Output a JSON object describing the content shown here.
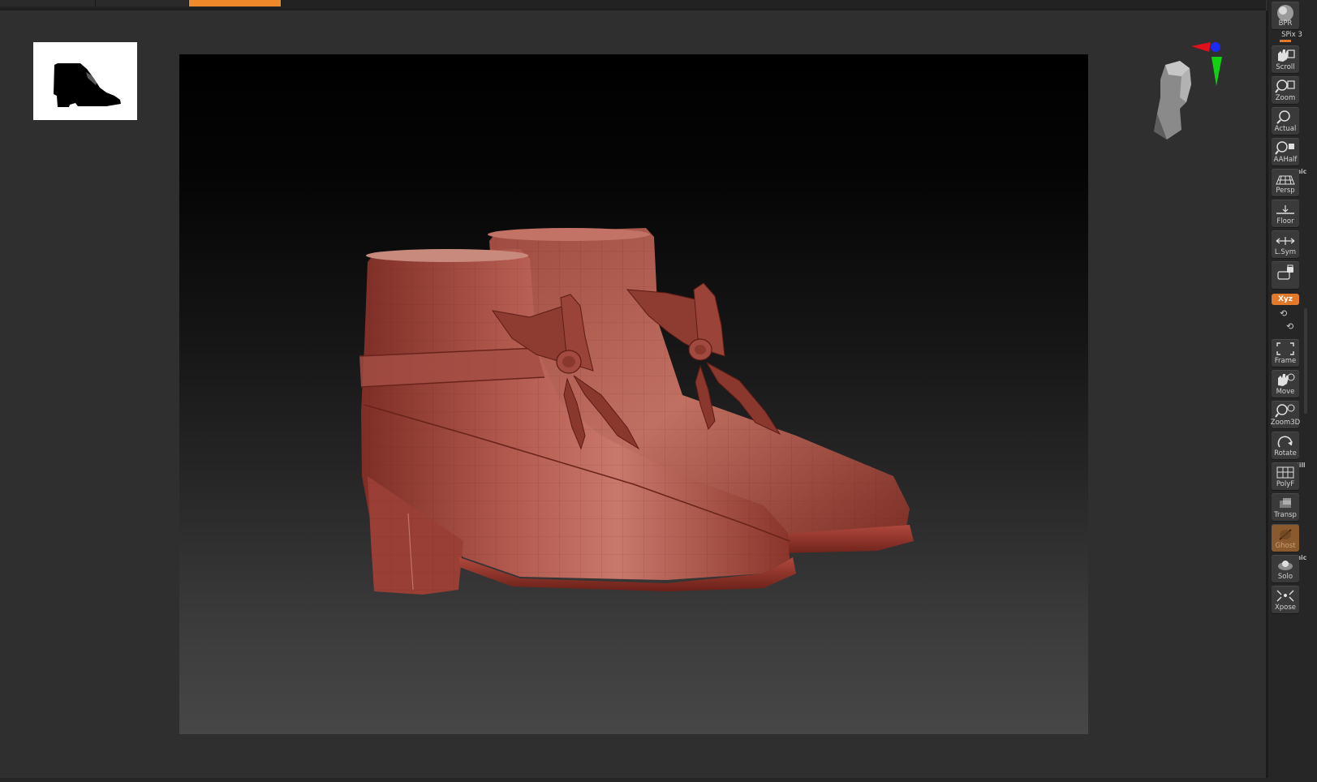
{
  "top_tabs": [
    {
      "state": "inactive"
    },
    {
      "state": "inactive"
    },
    {
      "state": "active"
    }
  ],
  "colors": {
    "accent_orange": "#ee8a2a",
    "shoe_clay": "#a8493f",
    "viewport_top": "#000000",
    "viewport_bottom": "#474747",
    "gizmo_x": "#e0101a",
    "gizmo_y": "#12d012",
    "gizmo_z": "#1a2cf0"
  },
  "right_tray": {
    "bpr": {
      "label": "BPR",
      "icon": "sphere-icon"
    },
    "spix": {
      "label": "SPix 3"
    },
    "scroll": {
      "label": "Scroll",
      "icon": "hand-icon"
    },
    "zoom": {
      "label": "Zoom",
      "icon": "magnifier-icon"
    },
    "actual": {
      "label": "Actual",
      "icon": "magnifier-icon"
    },
    "aahalf": {
      "label": "AAHalf",
      "icon": "magnifier-icon"
    },
    "persp": {
      "super": "Dynamic",
      "label": "Persp",
      "icon": "perspective-grid-icon"
    },
    "floor": {
      "label": "Floor",
      "icon": "floor-icon"
    },
    "lsym": {
      "label": "L.Sym",
      "icon": "symmetry-arrows-icon"
    },
    "lock": {
      "icon": "camera-lock-icon"
    },
    "xyz": {
      "label": "Xyz"
    },
    "frame": {
      "label": "Frame",
      "icon": "frame-icon"
    },
    "move": {
      "label": "Move",
      "icon": "hand-icon"
    },
    "zoom3d": {
      "label": "Zoom3D",
      "icon": "magnifier-icon"
    },
    "rotate": {
      "label": "Rotate",
      "icon": "rotate-icon"
    },
    "polyf": {
      "super": "Line Fill",
      "label": "PolyF",
      "icon": "polyframe-icon"
    },
    "transp": {
      "label": "Transp",
      "icon": "transparency-icon"
    },
    "ghost": {
      "label": "Ghost",
      "icon": "ghost-icon"
    },
    "solo": {
      "super": "Dynamic",
      "label": "Solo",
      "icon": "solo-icon"
    },
    "xpose": {
      "label": "Xpose",
      "icon": "xpose-icon"
    }
  }
}
